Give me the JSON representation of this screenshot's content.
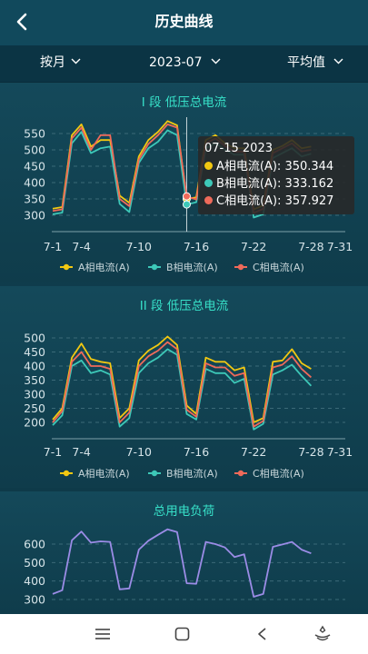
{
  "header": {
    "title": "历史曲线"
  },
  "filters": {
    "period": "按月",
    "month": "2023-07",
    "stat": "平均值"
  },
  "colors": {
    "a": "#f2c811",
    "b": "#3dc8b8",
    "c": "#ef6a5a",
    "load": "#9b8ce6"
  },
  "chart_data": [
    {
      "type": "line",
      "title": "I 段 低压总电流",
      "x_ticks": [
        "7-1",
        "7-4",
        "7-10",
        "7-16",
        "7-22",
        "7-28",
        "7-31"
      ],
      "ylim": [
        300,
        550
      ],
      "y_ticks": [
        "550",
        "500",
        "450",
        "400",
        "350",
        "300"
      ],
      "x": [
        1,
        2,
        3,
        4,
        5,
        6,
        7,
        8,
        9,
        10,
        11,
        12,
        13,
        14,
        15,
        16,
        17,
        18,
        19,
        20,
        21,
        22,
        23,
        24,
        25,
        26,
        27,
        28
      ],
      "series": [
        {
          "name": "A相电流(A)",
          "values": [
            320,
            325,
            545,
            578,
            510,
            530,
            530,
            360,
            338,
            480,
            530,
            555,
            588,
            575,
            350,
            355,
            530,
            545,
            520,
            505,
            505,
            318,
            330,
            500,
            512,
            530,
            505,
            510
          ]
        },
        {
          "name": "B相电流(A)",
          "values": [
            303,
            308,
            520,
            555,
            490,
            505,
            510,
            335,
            310,
            460,
            505,
            525,
            560,
            545,
            333,
            340,
            505,
            520,
            500,
            485,
            485,
            293,
            303,
            475,
            490,
            505,
            480,
            488
          ]
        },
        {
          "name": "C相电流(A)",
          "values": [
            313,
            318,
            535,
            568,
            500,
            545,
            545,
            350,
            328,
            470,
            518,
            545,
            578,
            568,
            358,
            348,
            520,
            535,
            512,
            495,
            495,
            307,
            320,
            490,
            505,
            520,
            495,
            500
          ]
        }
      ],
      "tooltip": {
        "date": "07-15 2023",
        "rows": [
          "A相电流(A): 350.344",
          "B相电流(A): 333.162",
          "C相电流(A): 357.927"
        ]
      },
      "legend": [
        "A相电流(A)",
        "B相电流(A)",
        "C相电流(A)"
      ]
    },
    {
      "type": "line",
      "title": "II 段 低压总电流",
      "x_ticks": [
        "7-1",
        "7-4",
        "7-10",
        "7-16",
        "7-22",
        "7-28",
        "7-31"
      ],
      "ylim": [
        175,
        525
      ],
      "y_ticks": [
        "500",
        "450",
        "400",
        "350",
        "300",
        "250",
        "200"
      ],
      "x": [
        1,
        2,
        3,
        4,
        5,
        6,
        7,
        8,
        9,
        10,
        11,
        12,
        13,
        14,
        15,
        16,
        17,
        18,
        19,
        20,
        21,
        22,
        23,
        24,
        25,
        26,
        27,
        28
      ],
      "series": [
        {
          "name": "A相电流(A)",
          "values": [
            210,
            250,
            430,
            480,
            425,
            415,
            410,
            215,
            250,
            420,
            455,
            475,
            505,
            475,
            260,
            230,
            430,
            415,
            415,
            385,
            395,
            200,
            215,
            415,
            420,
            460,
            410,
            390
          ]
        },
        {
          "name": "B相电流(A)",
          "values": [
            190,
            225,
            400,
            420,
            375,
            385,
            370,
            185,
            215,
            375,
            410,
            430,
            460,
            440,
            230,
            210,
            390,
            375,
            375,
            340,
            355,
            175,
            195,
            370,
            385,
            405,
            365,
            330
          ]
        },
        {
          "name": "C相电流(A)",
          "values": [
            200,
            240,
            415,
            450,
            400,
            400,
            390,
            200,
            235,
            400,
            435,
            455,
            485,
            460,
            245,
            220,
            410,
            395,
            395,
            365,
            375,
            185,
            205,
            395,
            405,
            435,
            390,
            360
          ]
        }
      ],
      "legend": [
        "A相电流(A)",
        "B相电流(A)",
        "C相电流(A)"
      ]
    },
    {
      "type": "line",
      "title": "总用电负荷",
      "ylim": [
        300,
        650
      ],
      "y_ticks": [
        "600",
        "500",
        "400",
        "300"
      ],
      "x": [
        1,
        2,
        3,
        4,
        5,
        6,
        7,
        8,
        9,
        10,
        11,
        12,
        13,
        14,
        15,
        16,
        17,
        18,
        19,
        20,
        21,
        22,
        23,
        24,
        25,
        26,
        27,
        28
      ],
      "series": [
        {
          "name": "",
          "values": [
            330,
            350,
            620,
            668,
            608,
            615,
            612,
            355,
            360,
            570,
            618,
            650,
            680,
            665,
            388,
            385,
            612,
            600,
            582,
            530,
            545,
            315,
            330,
            585,
            598,
            612,
            570,
            550
          ]
        }
      ]
    }
  ]
}
